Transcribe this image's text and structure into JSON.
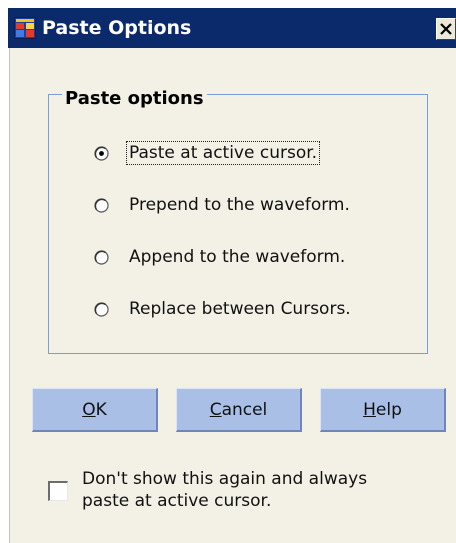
{
  "window": {
    "title": "Paste Options",
    "close_symbol": "×"
  },
  "group": {
    "label": "Paste options"
  },
  "options": [
    {
      "label": "Paste at active cursor.",
      "selected": true
    },
    {
      "label": "Prepend to the waveform.",
      "selected": false
    },
    {
      "label": "Append to the waveform.",
      "selected": false
    },
    {
      "label": "Replace between Cursors.",
      "selected": false
    }
  ],
  "buttons": {
    "ok": {
      "mnemonic": "O",
      "rest": "K"
    },
    "cancel": {
      "mnemonic": "C",
      "rest": "ancel"
    },
    "help": {
      "mnemonic": "H",
      "rest": "elp"
    }
  },
  "dont_show": {
    "line1": "Don't show this again and always",
    "line2": "paste at active cursor.",
    "checked": false
  },
  "colors": {
    "titlebar": "#0a2a6b",
    "dialog_bg": "#f3f1e6",
    "button_bg": "#a9bfe6",
    "groupbox_border": "#7a9fd6"
  },
  "icons": {
    "app": "windows-form-icon",
    "close": "close-x-icon"
  }
}
